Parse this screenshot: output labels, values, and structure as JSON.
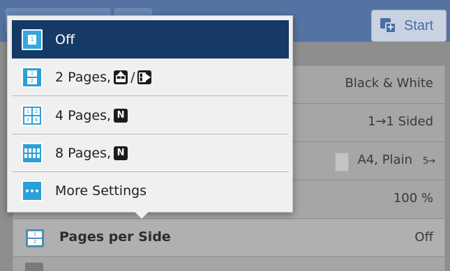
{
  "toolbar": {
    "start_label": "Start"
  },
  "settings_panel": {
    "color_mode": "Black & White",
    "sided": "1→1 Sided",
    "paper": "A4, Plain",
    "paper_tray_glyph": "5→",
    "zoom": "100 %",
    "pages_per_side": {
      "label": "Pages per Side",
      "value": "Off",
      "icon_pages": [
        "1",
        "2"
      ]
    }
  },
  "menu": {
    "items": [
      {
        "label": "Off",
        "icon": "single-page-icon",
        "selected": true,
        "icon_pages": [
          "1"
        ]
      },
      {
        "label": "2 Pages,",
        "icon": "two-pages-icon",
        "selected": false,
        "icon_pages": [
          "1",
          "2"
        ],
        "badges": [
          "portrait-up-icon",
          "landscape-right-icon"
        ],
        "separator": "/"
      },
      {
        "label": "4 Pages,",
        "icon": "four-pages-icon",
        "selected": false,
        "icon_pages": [
          "1",
          "2",
          "3",
          "4"
        ],
        "badges": [
          "n-order-icon"
        ],
        "badge_text": "N"
      },
      {
        "label": "8 Pages,",
        "icon": "eight-pages-icon",
        "selected": false,
        "badges": [
          "n-order-icon"
        ],
        "badge_text": "N"
      },
      {
        "label": "More Settings",
        "icon": "more-dots-icon",
        "selected": false
      }
    ]
  },
  "colors": {
    "selected_bg": "#153a66",
    "icon_blue": "#2aa0d8",
    "topbar": "#5573a2"
  }
}
